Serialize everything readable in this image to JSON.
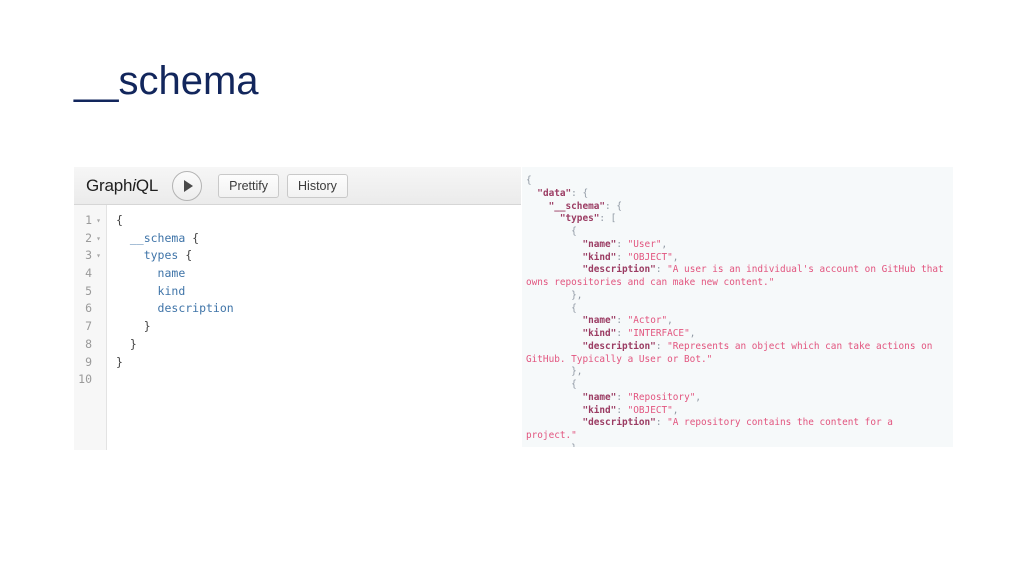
{
  "slide": {
    "title": "__schema",
    "title_color": "#12265c"
  },
  "graphiql": {
    "toolbar": {
      "logo_prefix": "Graph",
      "logo_italic": "i",
      "logo_suffix": "QL",
      "execute_icon": "play-icon",
      "prettify_label": "Prettify",
      "history_label": "History"
    },
    "editor": {
      "gutter": [
        {
          "number": "1",
          "fold": "▾"
        },
        {
          "number": "2",
          "fold": "▾"
        },
        {
          "number": "3",
          "fold": "▾"
        },
        {
          "number": "4",
          "fold": ""
        },
        {
          "number": "5",
          "fold": ""
        },
        {
          "number": "6",
          "fold": ""
        },
        {
          "number": "7",
          "fold": ""
        },
        {
          "number": "8",
          "fold": ""
        },
        {
          "number": "9",
          "fold": ""
        },
        {
          "number": "10",
          "fold": ""
        }
      ],
      "lines": [
        [
          {
            "t": "{",
            "c": "punct"
          }
        ],
        [
          {
            "t": "  ",
            "c": "punct"
          },
          {
            "t": "__schema",
            "c": "field"
          },
          {
            "t": " {",
            "c": "punct"
          }
        ],
        [
          {
            "t": "    ",
            "c": "punct"
          },
          {
            "t": "types",
            "c": "field"
          },
          {
            "t": " {",
            "c": "punct"
          }
        ],
        [
          {
            "t": "      ",
            "c": "punct"
          },
          {
            "t": "name",
            "c": "field"
          }
        ],
        [
          {
            "t": "      ",
            "c": "punct"
          },
          {
            "t": "kind",
            "c": "field"
          }
        ],
        [
          {
            "t": "      ",
            "c": "punct"
          },
          {
            "t": "description",
            "c": "field"
          }
        ],
        [
          {
            "t": "    }",
            "c": "punct"
          }
        ],
        [
          {
            "t": "  }",
            "c": "punct"
          }
        ],
        [
          {
            "t": "}",
            "c": "punct"
          }
        ],
        [
          {
            "t": "",
            "c": "punct"
          }
        ]
      ]
    }
  },
  "result": {
    "lines": [
      [
        {
          "t": "{",
          "c": "punct"
        }
      ],
      [
        {
          "t": "  ",
          "c": "punct"
        },
        {
          "t": "\"data\"",
          "c": "key"
        },
        {
          "t": ": {",
          "c": "punct"
        }
      ],
      [
        {
          "t": "    ",
          "c": "punct"
        },
        {
          "t": "\"__schema\"",
          "c": "key"
        },
        {
          "t": ": {",
          "c": "punct"
        }
      ],
      [
        {
          "t": "      ",
          "c": "punct"
        },
        {
          "t": "\"types\"",
          "c": "key"
        },
        {
          "t": ": [",
          "c": "punct"
        }
      ],
      [
        {
          "t": "        {",
          "c": "punct"
        }
      ],
      [
        {
          "t": "          ",
          "c": "punct"
        },
        {
          "t": "\"name\"",
          "c": "key"
        },
        {
          "t": ": ",
          "c": "punct"
        },
        {
          "t": "\"User\"",
          "c": "str"
        },
        {
          "t": ",",
          "c": "punct"
        }
      ],
      [
        {
          "t": "          ",
          "c": "punct"
        },
        {
          "t": "\"kind\"",
          "c": "key"
        },
        {
          "t": ": ",
          "c": "punct"
        },
        {
          "t": "\"OBJECT\"",
          "c": "str"
        },
        {
          "t": ",",
          "c": "punct"
        }
      ],
      [
        {
          "t": "          ",
          "c": "punct"
        },
        {
          "t": "\"description\"",
          "c": "key"
        },
        {
          "t": ": ",
          "c": "punct"
        },
        {
          "t": "\"A user is an individual's account on GitHub that owns repositories and can make new content.\"",
          "c": "str"
        }
      ],
      [
        {
          "t": "        },",
          "c": "punct"
        }
      ],
      [
        {
          "t": "        {",
          "c": "punct"
        }
      ],
      [
        {
          "t": "          ",
          "c": "punct"
        },
        {
          "t": "\"name\"",
          "c": "key"
        },
        {
          "t": ": ",
          "c": "punct"
        },
        {
          "t": "\"Actor\"",
          "c": "str"
        },
        {
          "t": ",",
          "c": "punct"
        }
      ],
      [
        {
          "t": "          ",
          "c": "punct"
        },
        {
          "t": "\"kind\"",
          "c": "key"
        },
        {
          "t": ": ",
          "c": "punct"
        },
        {
          "t": "\"INTERFACE\"",
          "c": "str"
        },
        {
          "t": ",",
          "c": "punct"
        }
      ],
      [
        {
          "t": "          ",
          "c": "punct"
        },
        {
          "t": "\"description\"",
          "c": "key"
        },
        {
          "t": ": ",
          "c": "punct"
        },
        {
          "t": "\"Represents an object which can take actions on GitHub. Typically a User or Bot.\"",
          "c": "str"
        }
      ],
      [
        {
          "t": "        },",
          "c": "punct"
        }
      ],
      [
        {
          "t": "        {",
          "c": "punct"
        }
      ],
      [
        {
          "t": "          ",
          "c": "punct"
        },
        {
          "t": "\"name\"",
          "c": "key"
        },
        {
          "t": ": ",
          "c": "punct"
        },
        {
          "t": "\"Repository\"",
          "c": "str"
        },
        {
          "t": ",",
          "c": "punct"
        }
      ],
      [
        {
          "t": "          ",
          "c": "punct"
        },
        {
          "t": "\"kind\"",
          "c": "key"
        },
        {
          "t": ": ",
          "c": "punct"
        },
        {
          "t": "\"OBJECT\"",
          "c": "str"
        },
        {
          "t": ",",
          "c": "punct"
        }
      ],
      [
        {
          "t": "          ",
          "c": "punct"
        },
        {
          "t": "\"description\"",
          "c": "key"
        },
        {
          "t": ": ",
          "c": "punct"
        },
        {
          "t": "\"A repository contains the content for a project.\"",
          "c": "str"
        }
      ],
      [
        {
          "t": "        },",
          "c": "punct"
        }
      ],
      [
        {
          "t": "        {",
          "c": "punct"
        }
      ]
    ]
  }
}
